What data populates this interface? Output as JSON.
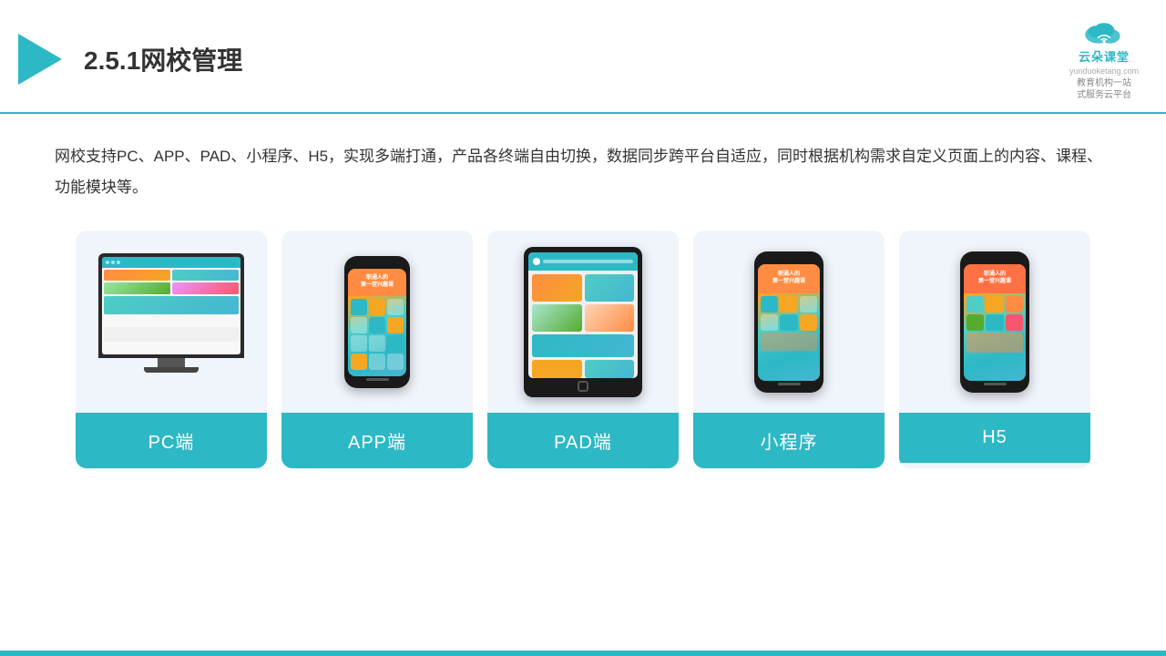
{
  "header": {
    "title_prefix": "2.5.1",
    "title_main": "网校管理",
    "brand_name": "云朵课堂",
    "brand_url": "yunduoketang.com",
    "brand_tagline_line1": "教育机构一站",
    "brand_tagline_line2": "式服务云平台"
  },
  "description": "网校支持PC、APP、PAD、小程序、H5，实现多端打通，产品各终端自由切换，数据同步跨平台自适应，同时根据机构需求自定义页面上的内容、课程、功能模块等。",
  "cards": [
    {
      "id": "pc",
      "label": "PC端"
    },
    {
      "id": "app",
      "label": "APP端"
    },
    {
      "id": "pad",
      "label": "PAD端"
    },
    {
      "id": "miniprogram",
      "label": "小程序"
    },
    {
      "id": "h5",
      "label": "H5"
    }
  ],
  "colors": {
    "accent": "#2db8c5",
    "bg_card": "#f0f4fb",
    "text_dark": "#333333"
  }
}
